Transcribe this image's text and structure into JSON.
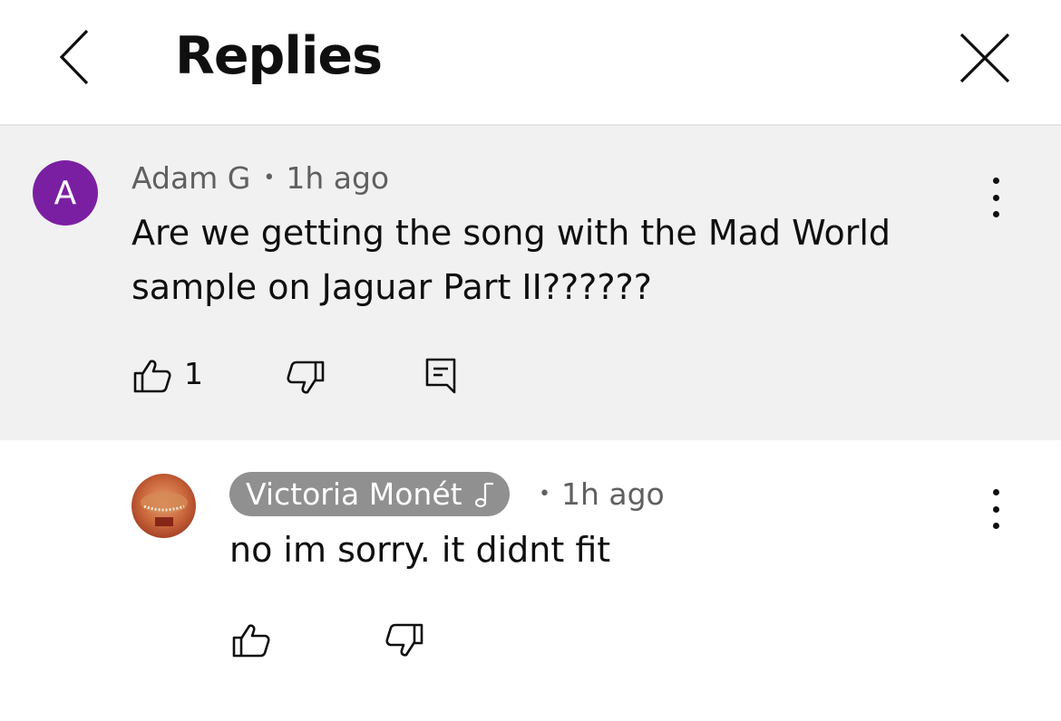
{
  "header": {
    "title": "Replies",
    "back_icon": "chevron-left-icon",
    "close_icon": "close-icon"
  },
  "parent_comment": {
    "avatar_letter": "A",
    "avatar_color": "#7b1fa2",
    "author": "Adam G",
    "separator": "•",
    "time": "1h ago",
    "text_line1": "Are we getting the song with the Mad World",
    "text_line2": "sample on Jaguar Part II??????",
    "like_count": "1",
    "background": "#f1f1f1"
  },
  "reply": {
    "author": "Victoria Monét",
    "author_badge_icon": "music-note-icon",
    "separator": "•",
    "time": "1h ago",
    "text": "no im sorry. it didnt fit",
    "chip_color": "#909090"
  }
}
